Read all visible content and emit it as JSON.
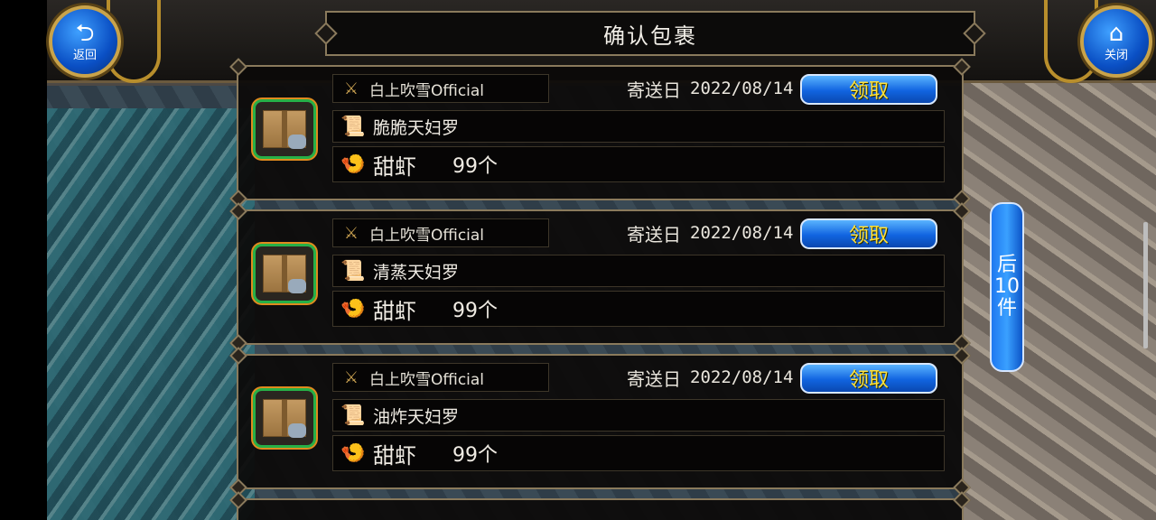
{
  "header": {
    "title": "确认包裹",
    "back_label": "返回",
    "close_label": "关闭"
  },
  "parcels": [
    {
      "sender": "白上吹雪Official",
      "date_label": "寄送日",
      "date": "2022/08/14",
      "claim_label": "领取",
      "item_name": "脆脆天妇罗",
      "reward_name": "甜虾",
      "reward_qty": "99个"
    },
    {
      "sender": "白上吹雪Official",
      "date_label": "寄送日",
      "date": "2022/08/14",
      "claim_label": "领取",
      "item_name": "清蒸天妇罗",
      "reward_name": "甜虾",
      "reward_qty": "99个"
    },
    {
      "sender": "白上吹雪Official",
      "date_label": "寄送日",
      "date": "2022/08/14",
      "claim_label": "领取",
      "item_name": "油炸天妇罗",
      "reward_name": "甜虾",
      "reward_qty": "99个"
    }
  ],
  "next_button_label": "后\n10\n件",
  "colors": {
    "claim_text": "#ffe23a",
    "button_blue": "#1164e0",
    "frame_gold": "#8a7a5c",
    "icon_border_green": "#27b047"
  },
  "icons": {
    "back": "return-arrow-icon",
    "close": "home-icon",
    "sender": "crossed-swords-icon",
    "item": "scroll-icon",
    "reward": "shrimp-food-icon",
    "parcel": "cardboard-box-icon"
  }
}
